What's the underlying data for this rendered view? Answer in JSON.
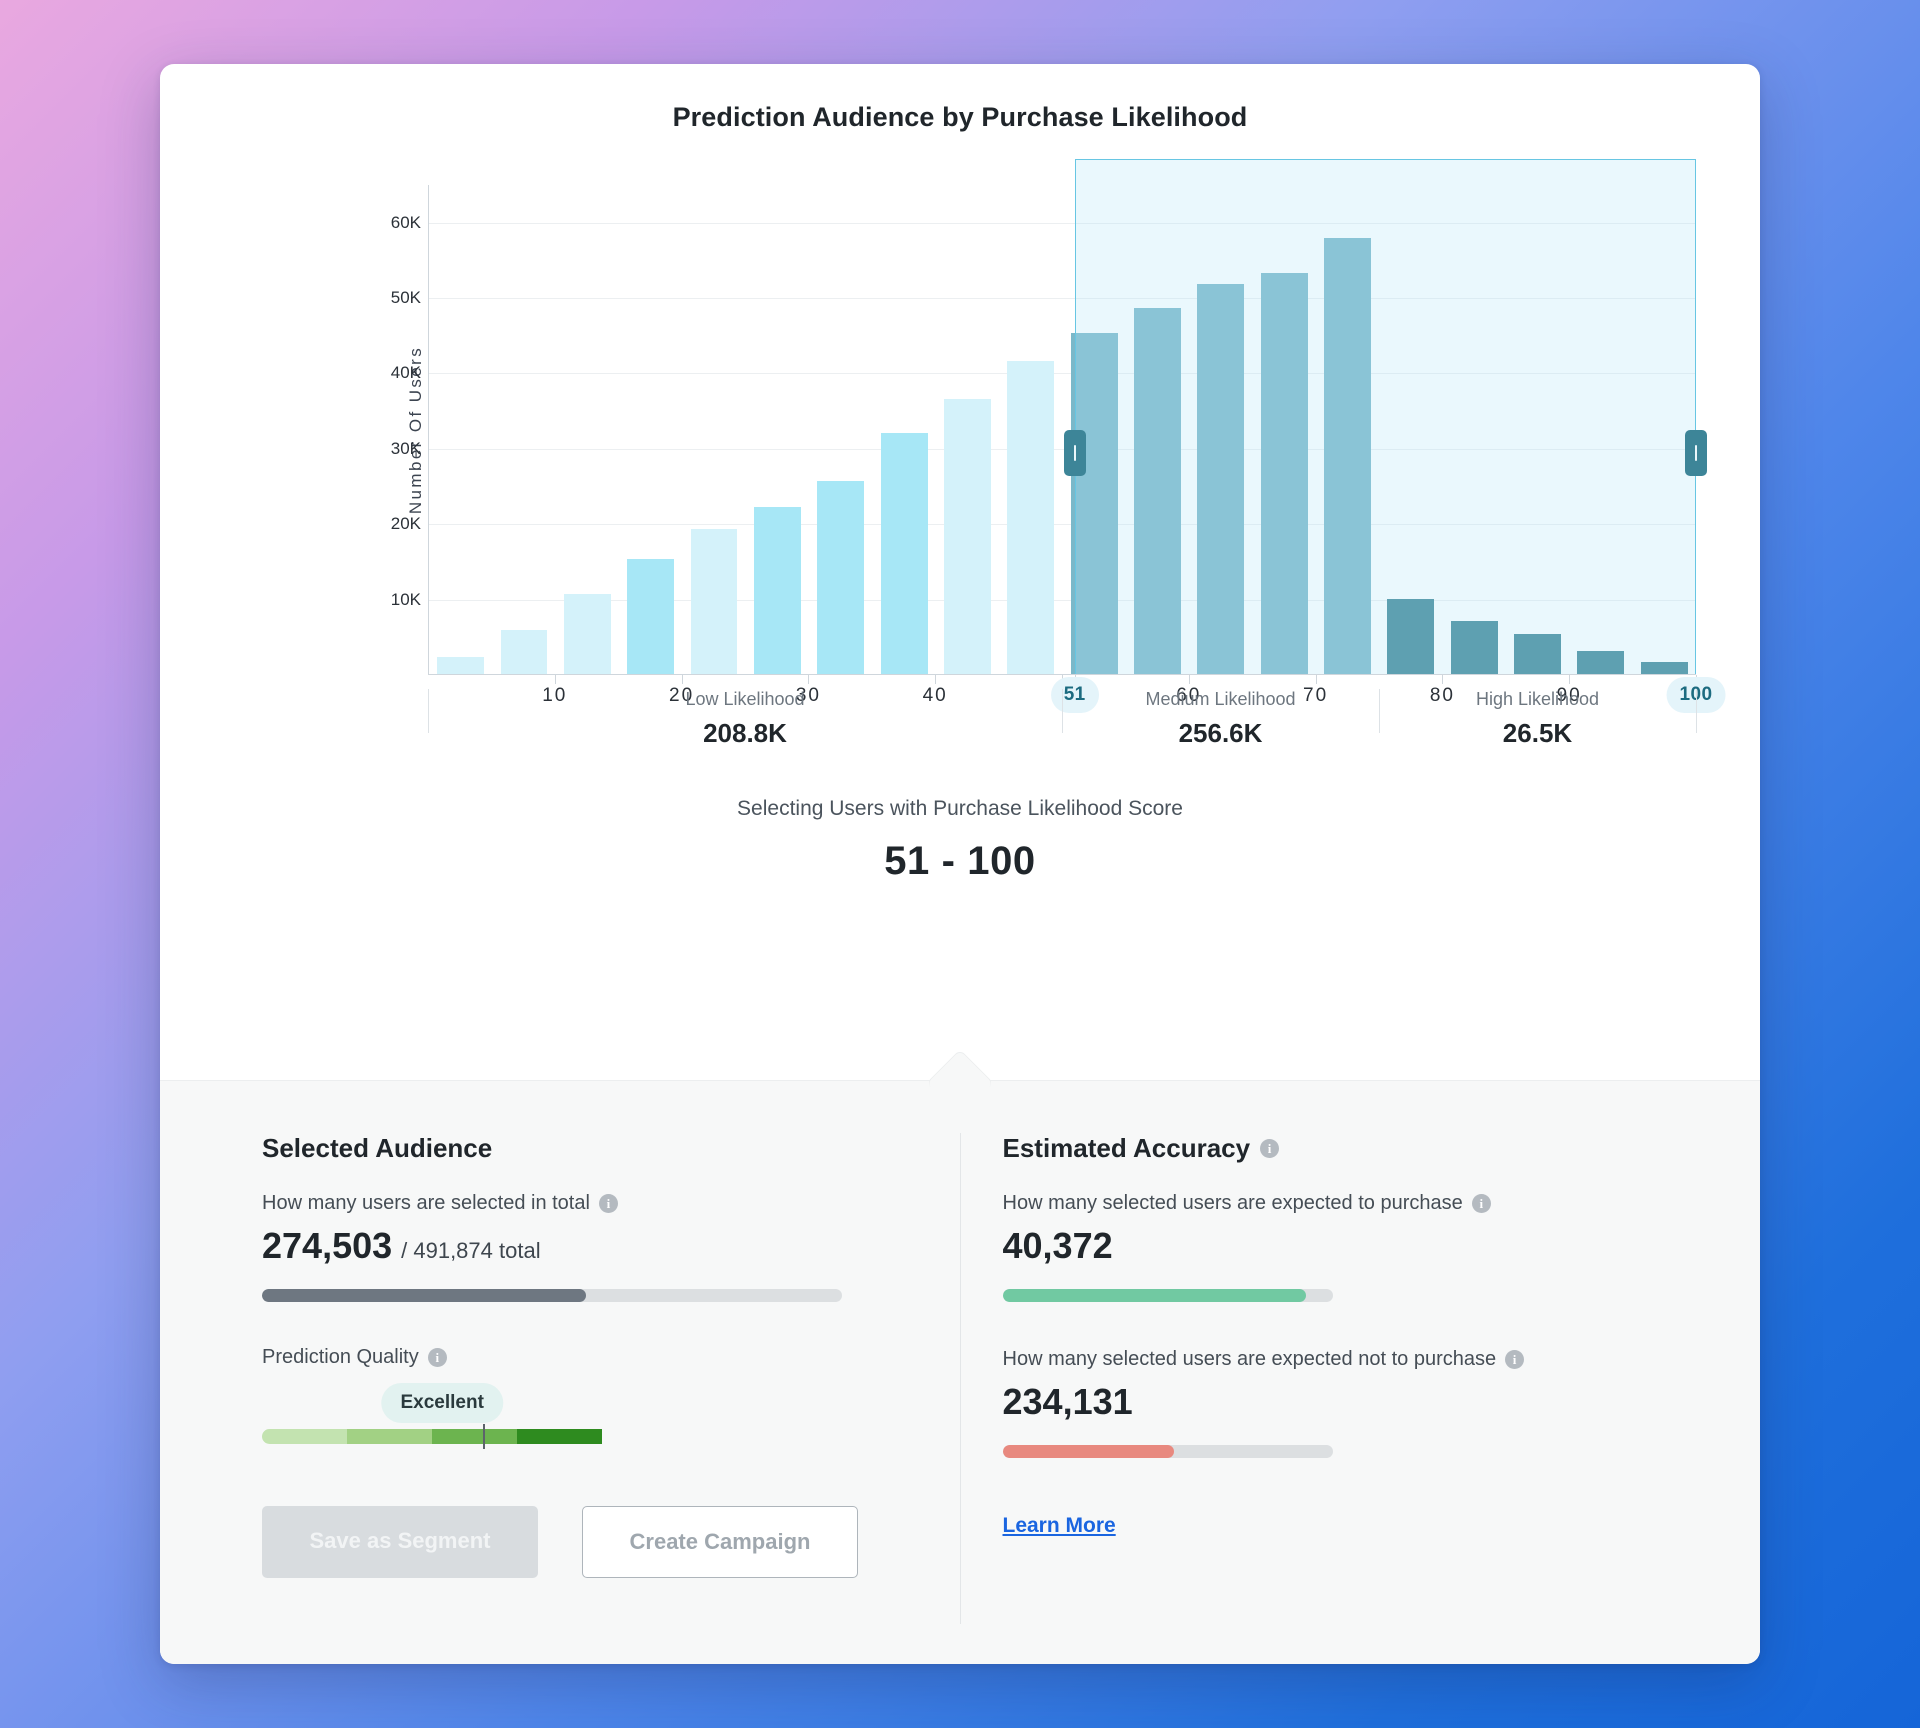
{
  "chart_data": {
    "type": "bar",
    "title": "Prediction Audience by Purchase Likelihood",
    "xlabel": "",
    "ylabel": "Number Of Users",
    "ylim": [
      0,
      65000
    ],
    "yticks": [
      10000,
      20000,
      30000,
      40000,
      50000,
      60000
    ],
    "ytick_labels": [
      "10K",
      "20K",
      "30K",
      "40K",
      "50K",
      "60K"
    ],
    "xticks": [
      10,
      20,
      30,
      40,
      60,
      70,
      80,
      90
    ],
    "xtick_labels": [
      "10",
      "20",
      "30",
      "40",
      "60",
      "70",
      "80",
      "90"
    ],
    "grid": true,
    "legend": "none",
    "bin_width": 5,
    "categories": [
      "0-5",
      "5-10",
      "10-15",
      "15-20",
      "20-25",
      "25-30",
      "30-35",
      "35-40",
      "40-45",
      "45-50",
      "50-55",
      "55-60",
      "60-65",
      "65-70",
      "70-75",
      "75-80",
      "80-85",
      "85-90",
      "90-95",
      "95-100"
    ],
    "values": [
      2300,
      5900,
      10600,
      15200,
      19300,
      22100,
      25600,
      32000,
      36500,
      41500,
      45300,
      48500,
      51700,
      53200,
      57800,
      10000,
      7000,
      5300,
      3000,
      1600
    ],
    "bar_colors": [
      "#d4f2fa",
      "#d4f2fa",
      "#d4f2fa",
      "#a7e7f6",
      "#d4f2fa",
      "#a7e7f6",
      "#a7e7f6",
      "#a7e7f6",
      "#d4f2fa",
      "#d4f2fa",
      "#7bb8c9",
      "#7bb8c9",
      "#7bb8c9",
      "#7bb8c9",
      "#7bb8c9",
      "#3d8596",
      "#3d8596",
      "#3d8596",
      "#3d8596",
      "#3d8596"
    ],
    "selection": {
      "start": 51,
      "end": 100,
      "start_label": "51",
      "end_label": "100"
    },
    "segments": [
      {
        "name": "Low Likelihood",
        "value": "208.8K",
        "from": 0,
        "to": 50
      },
      {
        "name": "Medium Likelihood",
        "value": "256.6K",
        "from": 50,
        "to": 75
      },
      {
        "name": "High Likelihood",
        "value": "26.5K",
        "from": 75,
        "to": 100
      }
    ],
    "colors": {
      "low": "#d4f2fa",
      "low_alt": "#a7e7f6",
      "medium": "#7bb8c9",
      "high": "#3d8596",
      "selection_fill": "#ddf2fa",
      "selection_border": "#67c6e3",
      "handle": "#3d8596"
    }
  },
  "select_caption": "Selecting Users with Purchase Likelihood Score",
  "select_range": "51 - 100",
  "panel": {
    "selected_audience": {
      "title": "Selected Audience",
      "total_label": "How many users are selected in total",
      "total_value": "274,503",
      "total_suffix": "/ 491,874 total",
      "total_percent": 55.8,
      "total_bar_color": "#6e7781",
      "quality_label": "Prediction Quality",
      "quality_badge": "Excellent",
      "quality_marker_percent": 65,
      "quality_badge_percent": 53,
      "quality_segments": [
        "#c3e3b0",
        "#a2d184",
        "#6cb44f",
        "#2e8b1f"
      ],
      "save_button": "Save as Segment",
      "create_button": "Create Campaign"
    },
    "estimated_accuracy": {
      "title": "Estimated Accuracy",
      "purchase_label": "How many selected users are expected to purchase",
      "purchase_value": "40,372",
      "purchase_percent": 92,
      "purchase_bar_color": "#71c9a2",
      "not_purchase_label": "How many selected users are expected not to purchase",
      "not_purchase_value": "234,131",
      "not_purchase_percent": 52,
      "not_purchase_bar_color": "#e8897f",
      "learn_more": "Learn More"
    }
  },
  "icons": {
    "info": "i"
  }
}
